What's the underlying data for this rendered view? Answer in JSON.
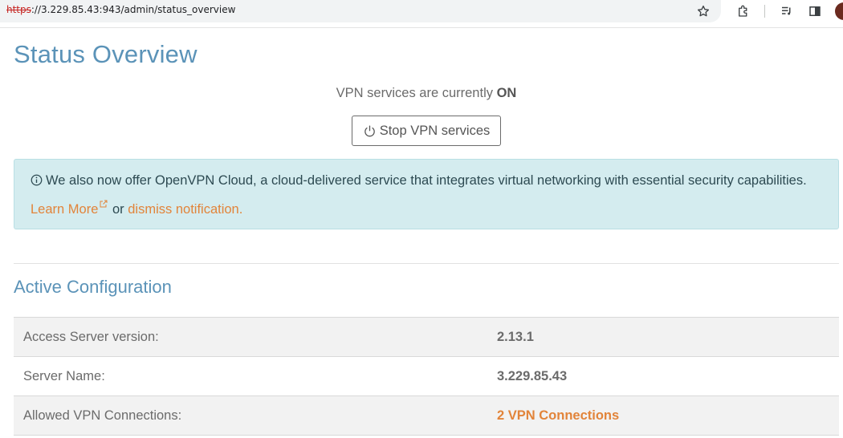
{
  "browser": {
    "url_scheme": "https",
    "url_rest": "://3.229.85.43:943/admin/status_overview",
    "icons": [
      "star-icon",
      "extensions-icon",
      "reading-list-icon",
      "side-panel-icon",
      "profile-avatar"
    ]
  },
  "page": {
    "title": "Status Overview",
    "status_prefix": "VPN services are currently",
    "status_value": "ON",
    "stop_button_label": "Stop VPN services"
  },
  "notice": {
    "text": "We also now offer OpenVPN Cloud, a cloud-delivered service that integrates virtual networking with essential security capabilities.",
    "learn_more": "Learn More",
    "or": "or",
    "dismiss": "dismiss notification."
  },
  "config": {
    "title": "Active Configuration",
    "rows": [
      {
        "label": "Access Server version:",
        "value": "2.13.1"
      },
      {
        "label": "Server Name:",
        "value": "3.229.85.43"
      },
      {
        "label": "Allowed VPN Connections:",
        "value": "2 VPN Connections"
      }
    ]
  },
  "colors": {
    "title_blue": "#5b93b8",
    "link_orange": "#e2843a",
    "notice_bg": "#d4ecef"
  }
}
